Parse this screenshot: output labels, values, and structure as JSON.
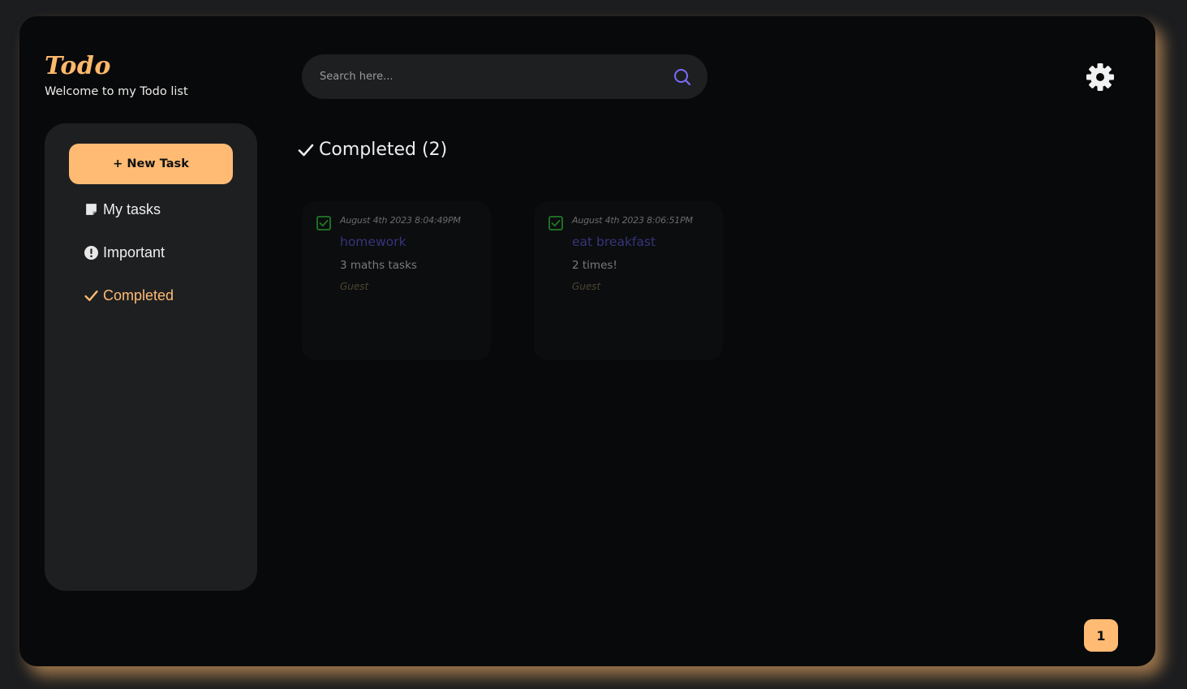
{
  "brand": {
    "title": "Todo",
    "subtitle": "Welcome to my Todo list"
  },
  "search": {
    "placeholder": "Search here...",
    "icon": "search-icon"
  },
  "settings": {
    "icon": "gear-icon"
  },
  "sidebar": {
    "new_task_label": "+ New Task",
    "items": [
      {
        "label": "My tasks",
        "icon": "note-icon"
      },
      {
        "label": "Important",
        "icon": "exclamation-icon"
      },
      {
        "label": "Completed",
        "icon": "check-icon",
        "active": true
      }
    ]
  },
  "main": {
    "section_title": "Completed (2)",
    "tasks": [
      {
        "date": "August 4th 2023 8:04:49PM",
        "title": "homework",
        "description": "3 maths tasks",
        "user": "Guest",
        "completed": true
      },
      {
        "date": "August 4th 2023 8:06:51PM",
        "title": "eat breakfast",
        "description": "2 times!",
        "user": "Guest",
        "completed": true
      }
    ]
  },
  "pagination": {
    "current": "1"
  },
  "colors": {
    "accent": "#ffbb73",
    "background": "#08090b",
    "panel": "#1e1f21",
    "search_icon": "#7b6cf6",
    "check": "#1f7a25"
  }
}
